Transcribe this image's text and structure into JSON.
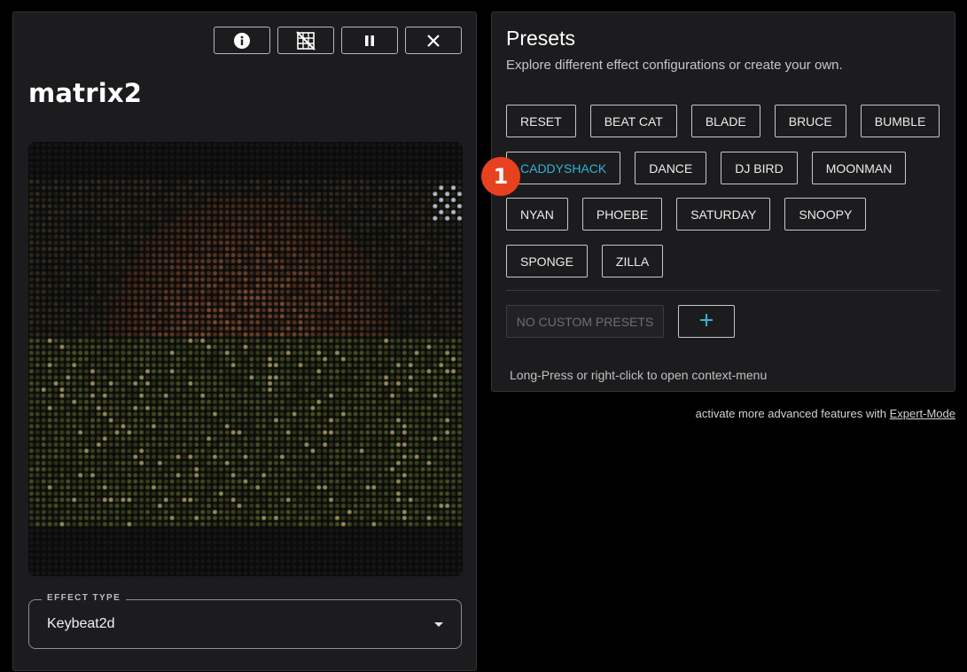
{
  "device": {
    "name": "matrix2",
    "toolbar": [
      {
        "name": "info-button",
        "icon": "info-icon"
      },
      {
        "name": "grid-off-button",
        "icon": "grid-off-icon"
      },
      {
        "name": "pause-button",
        "icon": "pause-icon"
      },
      {
        "name": "close-button",
        "icon": "close-icon"
      }
    ]
  },
  "effect": {
    "legend": "EFFECT TYPE",
    "value": "Keybeat2d"
  },
  "presets": {
    "title": "Presets",
    "subtitle": "Explore different effect configurations or create your own.",
    "rows": [
      [
        "RESET",
        "BEAT CAT",
        "BLADE",
        "BRUCE",
        "BUMBLE"
      ],
      [
        "CADDYSHACK",
        "DANCE",
        "DJ BIRD",
        "MOONMAN"
      ],
      [
        "NYAN",
        "PHOEBE",
        "SATURDAY",
        "SNOOPY"
      ],
      [
        "SPONGE",
        "ZILLA"
      ]
    ],
    "active": "CADDYSHACK",
    "badge": "1",
    "no_custom_label": "NO CUSTOM PRESETS",
    "add_icon": "plus-icon",
    "context_hint": "Long-Press or right-click to open context-menu"
  },
  "footer": {
    "expert_text": "activate more advanced features with",
    "expert_link": "Expert-Mode"
  },
  "colors": {
    "accent": "#2fb3d6",
    "badge": "#e8411f",
    "card_bg": "#1c1c1e",
    "page_bg": "#000000"
  }
}
